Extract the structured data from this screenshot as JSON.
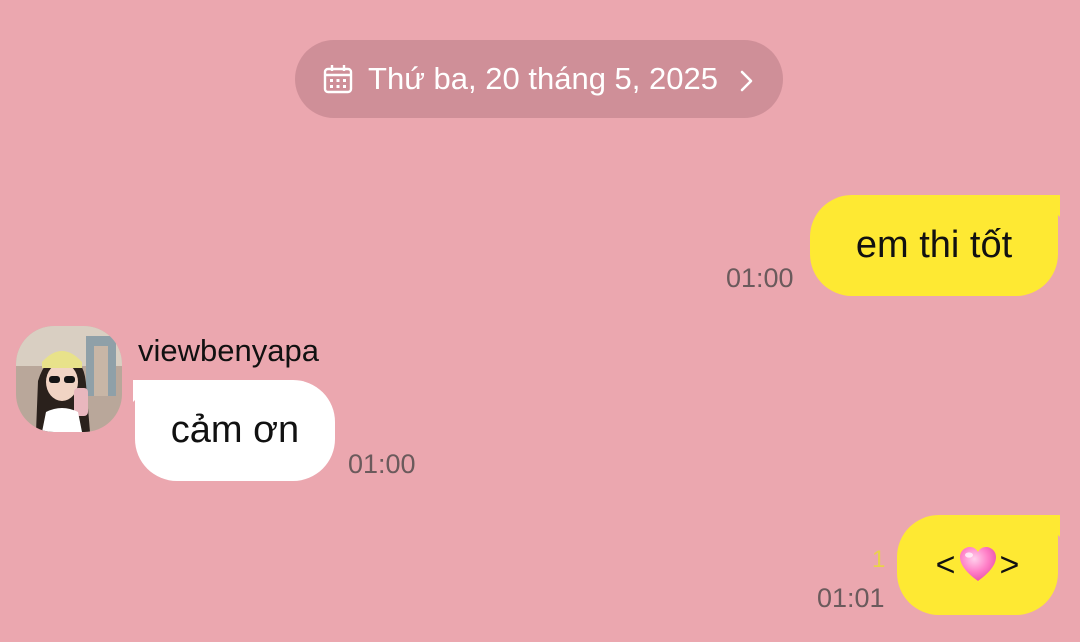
{
  "date_header": {
    "label": "Thứ ba, 20 tháng 5, 2025",
    "icon": "calendar-icon",
    "chevron": "chevron-right-icon"
  },
  "messages": [
    {
      "direction": "outgoing",
      "text": "em thi tốt",
      "time": "01:00"
    },
    {
      "direction": "incoming",
      "sender": "viewbenyapa",
      "text": "cảm ơn",
      "time": "01:00"
    },
    {
      "direction": "outgoing",
      "text_before": "<",
      "emoji": "pink-heart",
      "text_after": ">",
      "time": "01:01",
      "unread_count": "1"
    }
  ],
  "colors": {
    "background": "#eba7af",
    "date_pill": "#cf8f98",
    "outgoing_bubble": "#fee933",
    "incoming_bubble": "#ffffff",
    "unread_count": "#e9d24a"
  }
}
